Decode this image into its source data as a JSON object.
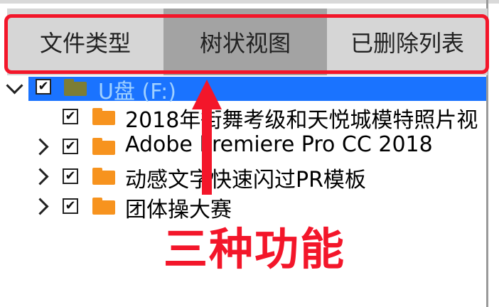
{
  "tabs": [
    {
      "label": "文件类型"
    },
    {
      "label": "树状视图"
    },
    {
      "label": "已删除列表"
    }
  ],
  "tree": {
    "root": {
      "label": "U盘 (F:)",
      "checked": "✔"
    },
    "children": [
      {
        "label": "2018年街舞考级和天悦城模特照片视",
        "checked": "✔"
      },
      {
        "label": "Adobe Premiere Pro CC 2018",
        "checked": "✔"
      },
      {
        "label": "动感文字快速闪过PR模板",
        "checked": "✔"
      },
      {
        "label": "团体操大赛",
        "checked": "✔"
      }
    ]
  },
  "annotation": {
    "text": "三种功能"
  },
  "colors": {
    "accent_red": "#f3162a",
    "selection_blue": "#1a73ff",
    "folder_orange": "#f7931e",
    "folder_olive": "#7c7d35"
  },
  "icons": [
    "chevron-down-icon",
    "chevron-right-icon",
    "checkbox-icon",
    "folder-icon",
    "arrow-up-icon"
  ]
}
